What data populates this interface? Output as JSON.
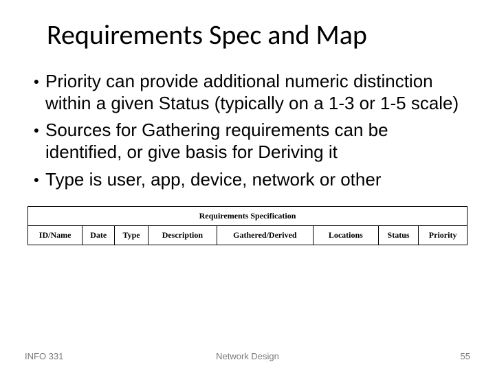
{
  "title": "Requirements Spec and Map",
  "bullets": [
    "Priority can provide additional numeric distinction within a given Status (typically on a 1-3 or 1-5 scale)",
    "Sources for Gathering requirements can be identified, or give basis for Deriving it",
    "Type is user, app, device, network or other"
  ],
  "table": {
    "caption": "Requirements Specification",
    "headers": [
      "ID/Name",
      "Date",
      "Type",
      "Description",
      "Gathered/Derived",
      "Locations",
      "Status",
      "Priority"
    ]
  },
  "footer": {
    "left": "INFO 331",
    "center": "Network Design",
    "right": "55"
  }
}
